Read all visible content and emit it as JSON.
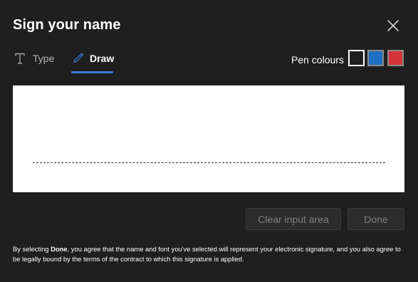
{
  "dialog": {
    "title": "Sign your name"
  },
  "tabs": [
    {
      "label": "Type",
      "icon": "text-type-icon",
      "selected": false
    },
    {
      "label": "Draw",
      "icon": "pen-icon",
      "selected": true
    }
  ],
  "pen_colours": {
    "label": "Pen colours",
    "options": [
      {
        "name": "black",
        "color": "#1f1f1f",
        "selected": true
      },
      {
        "name": "blue",
        "color": "#1e6fc2",
        "selected": false
      },
      {
        "name": "red",
        "color": "#d2343a",
        "selected": false
      }
    ]
  },
  "accent_color": "#3b7fd6",
  "buttons": {
    "clear_label": "Clear input area",
    "done_label": "Done"
  },
  "disclaimer": {
    "prefix": "By selecting ",
    "bold": "Done",
    "suffix": ", you agree that the name and font you've selected will represent your electronic signature, and you also agree to be legally bound by the terms of the contract to which this signature is applied."
  }
}
